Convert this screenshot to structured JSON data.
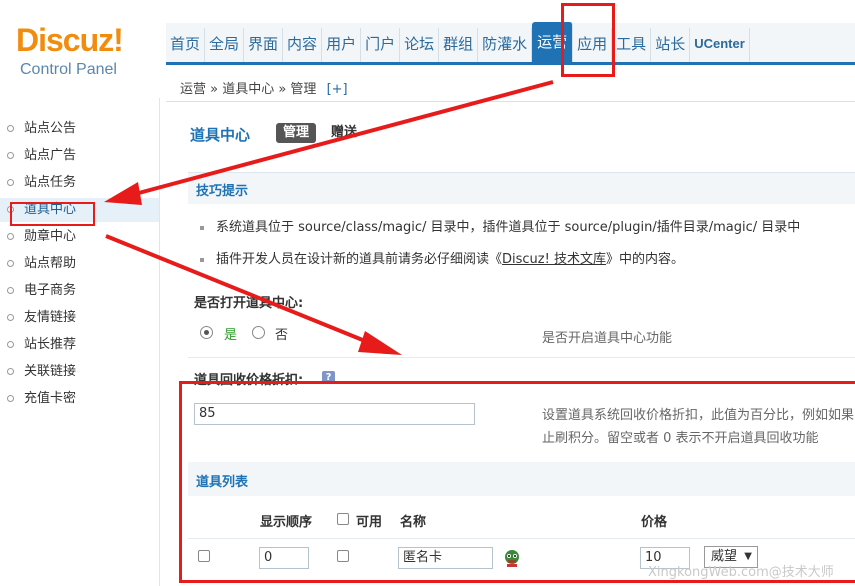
{
  "logo": {
    "brand": "Discuz!",
    "sub": "Control Panel"
  },
  "nav": {
    "items": [
      "首页",
      "全局",
      "界面",
      "内容",
      "用户",
      "门户",
      "论坛",
      "群组",
      "防灌水",
      "运营",
      "应用",
      "工具",
      "站长",
      "UCenter"
    ],
    "active_index": 9
  },
  "breadcrumb": {
    "text": "运营 » 道具中心 » 管理",
    "add": "[+]"
  },
  "sidebar": {
    "items": [
      "站点公告",
      "站点广告",
      "站点任务",
      "道具中心",
      "勋章中心",
      "站点帮助",
      "电子商务",
      "友情链接",
      "站长推荐",
      "关联链接",
      "充值卡密"
    ],
    "active_index": 3
  },
  "main": {
    "title": "道具中心",
    "tab_manage": "管理",
    "tab_gift": "赠送",
    "tips_title": "技巧提示",
    "tip1": "系统道具位于 source/class/magic/ 目录中，插件道具位于 source/plugin/插件目录/magic/ 目录中",
    "tip2_before": "插件开发人员在设计新的道具前请务必仔细阅读《",
    "tip2_link": "Discuz! 技术文库",
    "tip2_after": "》中的内容。",
    "open_label": "是否打开道具中心:",
    "open_yes": "是",
    "open_no": "否",
    "open_hint": "是否开启道具中心功能",
    "discount_label": "道具回收价格折扣:",
    "discount_value": "85",
    "discount_hint1": "设置道具系统回收价格折扣，此值为百分比，例如如果",
    "discount_hint2": "止刷积分。留空或者 0 表示不开启道具回收功能",
    "list_title": "道具列表",
    "col_order": "显示顺序",
    "col_enabled": "可用",
    "col_name": "名称",
    "col_price": "价格",
    "row1": {
      "order": "0",
      "name": "匿名卡",
      "price": "10",
      "currency": "威望"
    }
  },
  "watermark": "XingkongWeb.com@技术大师"
}
